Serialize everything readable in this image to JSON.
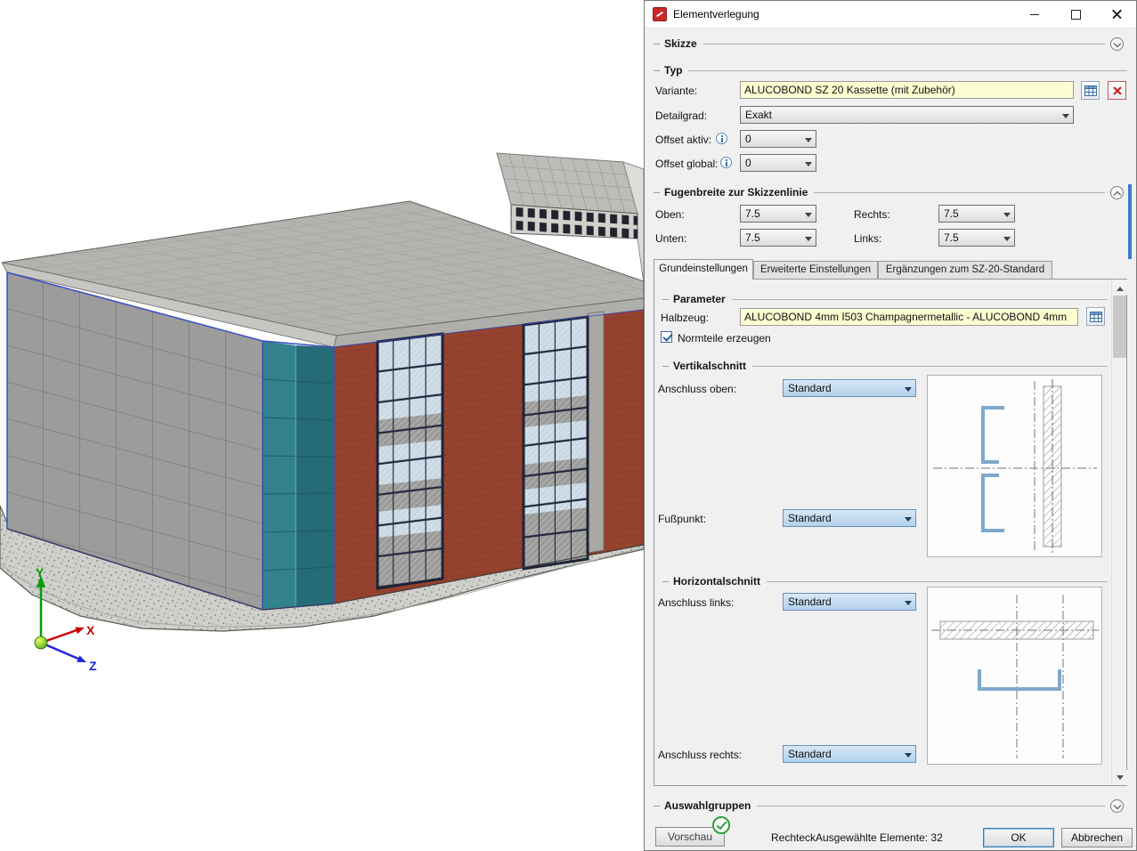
{
  "viewport": {
    "axes": {
      "x": "X",
      "y": "Y",
      "z": "Z"
    }
  },
  "dialog": {
    "title": "Elementverlegung",
    "skizze": {
      "label": "Skizze"
    },
    "typ": {
      "label": "Typ",
      "variante_label": "Variante:",
      "variante_value": "ALUCOBOND SZ 20 Kassette (mit Zubehör)",
      "detailgrad_label": "Detailgrad:",
      "detailgrad_value": "Exakt",
      "offset_aktiv_label": "Offset aktiv:",
      "offset_aktiv_value": "0",
      "offset_global_label": "Offset global:",
      "offset_global_value": "0"
    },
    "fugenbreite": {
      "label": "Fugenbreite zur Skizzenlinie",
      "oben_label": "Oben:",
      "oben_value": "7.5",
      "rechts_label": "Rechts:",
      "rechts_value": "7.5",
      "unten_label": "Unten:",
      "unten_value": "7.5",
      "links_label": "Links:",
      "links_value": "7.5"
    },
    "tabs": [
      {
        "label": "Grundeinstellungen",
        "active": true
      },
      {
        "label": "Erweiterte Einstellungen",
        "active": false
      },
      {
        "label": "Ergänzungen zum SZ-20-Standard",
        "active": false
      }
    ],
    "parameter": {
      "label": "Parameter",
      "halbzeug_label": "Halbzeug:",
      "halbzeug_value": "ALUCOBOND 4mm I503 Champagnermetallic - ALUCOBOND 4mm",
      "normteile_label": "Normteile erzeugen"
    },
    "vertikalschnitt": {
      "label": "Vertikalschnitt",
      "anschluss_oben_label": "Anschluss oben:",
      "anschluss_oben_value": "Standard",
      "fusspunkt_label": "Fußpunkt:",
      "fusspunkt_value": "Standard"
    },
    "horizontalschnitt": {
      "label": "Horizontalschnitt",
      "anschluss_links_label": "Anschluss links:",
      "anschluss_links_value": "Standard",
      "anschluss_rechts_label": "Anschluss rechts:",
      "anschluss_rechts_value": "Standard"
    },
    "auswahlgruppen": {
      "label": "Auswahlgruppen"
    },
    "footer": {
      "vorschau": "Vorschau",
      "shape": "Rechteck",
      "selected": "Ausgewählte Elemente: 32",
      "ok": "OK",
      "cancel": "Abbrechen"
    }
  },
  "colors": {
    "accent_blue": "#3a7ebf",
    "field_yellow": "#fdfdd2",
    "selection_teal": "#35828f",
    "wall_red": "#95422e"
  }
}
